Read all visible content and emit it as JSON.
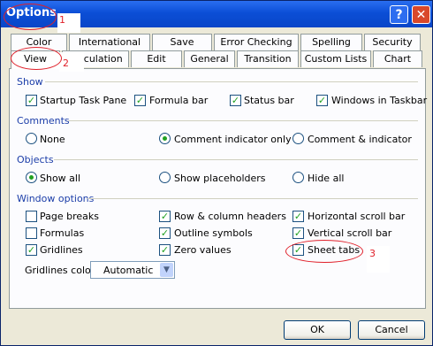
{
  "window": {
    "title": "Options"
  },
  "titlebar": {
    "help_glyph": "?",
    "close_glyph": "✕"
  },
  "annotations": [
    "1",
    "2",
    "3"
  ],
  "tabs_row1": [
    "Color",
    "International",
    "Save",
    "Error Checking",
    "Spelling",
    "Security"
  ],
  "tabs_row2": [
    "View",
    "Calculation",
    "Edit",
    "General",
    "Transition",
    "Custom Lists",
    "Chart"
  ],
  "show": {
    "heading": "Show",
    "items": [
      {
        "label": "Startup Task Pane",
        "checked": true
      },
      {
        "label": "Formula bar",
        "checked": true
      },
      {
        "label": "Status bar",
        "checked": true
      },
      {
        "label": "Windows in Taskbar",
        "checked": true
      }
    ]
  },
  "comments": {
    "heading": "Comments",
    "options": [
      {
        "label": "None",
        "selected": false
      },
      {
        "label": "Comment indicator only",
        "selected": true
      },
      {
        "label": "Comment & indicator",
        "selected": false
      }
    ]
  },
  "objects": {
    "heading": "Objects",
    "options": [
      {
        "label": "Show all",
        "selected": true
      },
      {
        "label": "Show placeholders",
        "selected": false
      },
      {
        "label": "Hide all",
        "selected": false
      }
    ]
  },
  "window_options": {
    "heading": "Window options",
    "items": [
      {
        "label": "Page breaks",
        "checked": false
      },
      {
        "label": "Row & column headers",
        "checked": true
      },
      {
        "label": "Horizontal scroll bar",
        "checked": true
      },
      {
        "label": "Formulas",
        "checked": false
      },
      {
        "label": "Outline symbols",
        "checked": true
      },
      {
        "label": "Vertical scroll bar",
        "checked": true
      },
      {
        "label": "Gridlines",
        "checked": true
      },
      {
        "label": "Zero values",
        "checked": true
      },
      {
        "label": "Sheet tabs",
        "checked": true
      }
    ],
    "gridlines_color_label": "Gridlines color:",
    "gridlines_color_value": "Automatic"
  },
  "buttons": {
    "ok": "OK",
    "cancel": "Cancel"
  },
  "check_glyph": "✓",
  "dropdown_glyph": "▼",
  "colors": {
    "titlebar": "#0b4ed6",
    "annotation": "#e0202a",
    "check": "#21a121",
    "group_heading": "#1b3da8"
  }
}
